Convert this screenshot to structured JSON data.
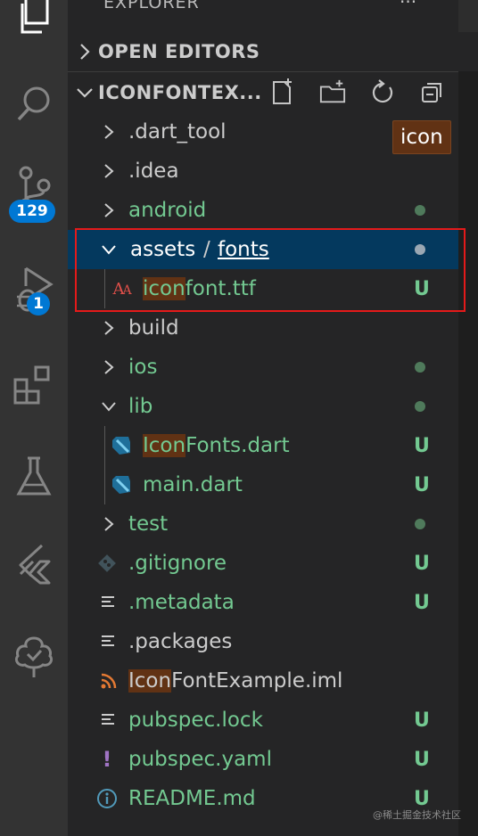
{
  "activity_bar": {
    "items": [
      {
        "name": "explorer-icon"
      },
      {
        "name": "search-icon"
      },
      {
        "name": "source-control-icon",
        "badge": "129"
      },
      {
        "name": "run-debug-icon",
        "badge": "1"
      },
      {
        "name": "extensions-icon"
      },
      {
        "name": "testing-icon"
      },
      {
        "name": "flutter-icon"
      },
      {
        "name": "remote-tree-icon"
      }
    ],
    "badge_color": "#0078d4"
  },
  "explorer": {
    "title": "EXPLORER",
    "more": "···",
    "open_editors": "OPEN EDITORS",
    "project": "ICONFONTEX...",
    "toolbar": [
      "new-file-icon",
      "new-folder-icon",
      "refresh-icon",
      "collapse-all-icon"
    ]
  },
  "tree": [
    {
      "label": ".dart_tool",
      "type": "folder",
      "expanded": false,
      "color": "grey"
    },
    {
      "label": ".idea",
      "type": "folder",
      "expanded": false,
      "color": "grey"
    },
    {
      "label": "android",
      "type": "folder",
      "expanded": false,
      "color": "green",
      "dot": true
    },
    {
      "label_a": "assets",
      "sep": "/",
      "label_b": "fonts",
      "type": "folder",
      "expanded": true,
      "selected": true,
      "dot": true
    },
    {
      "label_hl": "icon",
      "label_rest": "font.ttf",
      "type": "font-file",
      "status": "U"
    },
    {
      "label": "build",
      "type": "folder",
      "expanded": false,
      "color": "grey"
    },
    {
      "label": "ios",
      "type": "folder",
      "expanded": false,
      "color": "green",
      "dot": true
    },
    {
      "label": "lib",
      "type": "folder",
      "expanded": true,
      "color": "green",
      "dot": true
    },
    {
      "label_hl": "Icon",
      "label_rest": "Fonts.dart",
      "type": "dart-file",
      "status": "U"
    },
    {
      "label": "main.dart",
      "type": "dart-file",
      "status": "U"
    },
    {
      "label": "test",
      "type": "folder",
      "expanded": false,
      "color": "green",
      "dot": true
    },
    {
      "label": ".gitignore",
      "type": "git-file",
      "status": "U"
    },
    {
      "label": ".metadata",
      "type": "text-file",
      "status": "U"
    },
    {
      "label": ".packages",
      "type": "text-file",
      "color": "grey"
    },
    {
      "label_hl": "Icon",
      "label_rest": "FontExample.iml",
      "type": "rss-file",
      "color": "grey"
    },
    {
      "label": "pubspec.lock",
      "type": "text-file",
      "status": "U"
    },
    {
      "label": "pubspec.yaml",
      "type": "yaml-file",
      "status": "U"
    },
    {
      "label": "README.md",
      "type": "info-file",
      "status": "U"
    }
  ],
  "tooltip": "icon",
  "watermark": "@稀土掘金技术社区",
  "colors": {
    "untracked": "#73c991",
    "selection": "#04395e",
    "highlight": "#613214",
    "annotation": "#e51a1a"
  }
}
